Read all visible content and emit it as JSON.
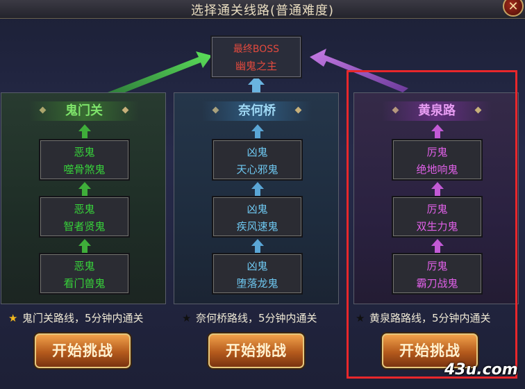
{
  "window": {
    "title": "选择通关线路(普通难度)",
    "close_glyph": "✕"
  },
  "boss": {
    "line1": "最终BOSS",
    "line2": "幽鬼之主"
  },
  "routes": [
    {
      "title": "鬼门关",
      "nodes": [
        {
          "rank": "恶鬼",
          "name": "噬骨煞鬼"
        },
        {
          "rank": "恶鬼",
          "name": "智者贤鬼"
        },
        {
          "rank": "恶鬼",
          "name": "看门兽鬼"
        }
      ],
      "info": "鬼门关路线，5分钟内通关",
      "star_glyph": "★",
      "button": "开始挑战"
    },
    {
      "title": "奈何桥",
      "nodes": [
        {
          "rank": "凶鬼",
          "name": "天心邪鬼"
        },
        {
          "rank": "凶鬼",
          "name": "疾风速鬼"
        },
        {
          "rank": "凶鬼",
          "name": "堕落龙鬼"
        }
      ],
      "info": "奈何桥路线，5分钟内通关",
      "star_glyph": "★",
      "button": "开始挑战"
    },
    {
      "title": "黄泉路",
      "nodes": [
        {
          "rank": "厉鬼",
          "name": "绝地响鬼"
        },
        {
          "rank": "厉鬼",
          "name": "双生力鬼"
        },
        {
          "rank": "厉鬼",
          "name": "霸刀战鬼"
        }
      ],
      "info": "黄泉路路线，5分钟内通关",
      "star_glyph": "★",
      "button": "开始挑战"
    }
  ],
  "colors": {
    "green": "#37d33a",
    "blue": "#6ec7f0",
    "purple": "#e060e8",
    "boss_red": "#e24a3e",
    "highlight": "#e8272b"
  },
  "watermark": "43u.com"
}
